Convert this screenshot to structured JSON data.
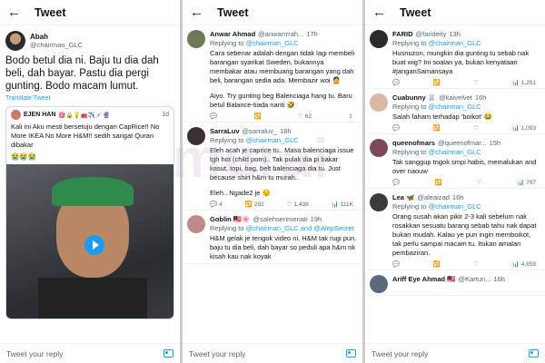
{
  "panels": [
    {
      "title": "Tweet",
      "reply_placeholder": "Tweet your reply",
      "main": {
        "name": "Abah",
        "handle": "@chairman_GLC",
        "text": "Bodo betul dia ni. Baju tu dia dah beli, dah bayar. Pastu dia pergi gunting. Bodo macam lumut.",
        "translate": "Translate Tweet",
        "quote": {
          "name": "EJEN HAN",
          "emoji": "🎯🔒💡🚒✈️💉🔮",
          "time": "1d",
          "text": "Kali ini Aku mesti bersetuju dengan CapRice!! No More IKEA No More H&M!! sedih sangat Quran dibakar",
          "emojis": "😭😭😭"
        }
      }
    },
    {
      "title": "Tweet",
      "reply_placeholder": "Tweet your reply",
      "tweets": [
        {
          "name": "Anwar Ahmad",
          "handle": "@anwarrrrah...",
          "time": "17h",
          "reply_to": "@chairman_GLC",
          "text": "Cara sebenar adalah dengan tidak lagi membeli barangan syarikat Sweden, bukannya membakar atau membuang barangan yang dah beli, barangan sedia ada. Membazir woi 🤦",
          "text2": "Aiyo. Try gunting beg Balenciaga hang tu. Baru betul Balance-tiada nanti 🤣",
          "likes": "62"
        },
        {
          "name": "SarraLuv",
          "handle": "@sarraluv_",
          "time": "18h",
          "reply_to": "@chairman_GLC",
          "text": "Eleh acah je caprice tu.. Masa balenciaga issue tgh hot (child porn).. Tak pulak dia pi bakar kasut, topi, bag, belt balenciaga dia tu. Just because shirt h&m tu murah..",
          "text2": "Eleh.. Ngade2 je 😒",
          "replies": "4",
          "retweets": "292",
          "likes": "1,438",
          "views": "111K"
        },
        {
          "name": "Goblin 🇲🇾🌸",
          "handle": "@salehserimenati",
          "time": "19h",
          "reply_to": "@chairman_GLC and @AlepSecret",
          "text": "H&M gelak je tengok video ni. H&M tak rugi pun. baju tu dia beli, dah bayar so peduli apa h&m nk kisah kau nak koyak"
        }
      ]
    },
    {
      "title": "Tweet",
      "reply_placeholder": "Tweet your reply",
      "tweets": [
        {
          "name": "FARID",
          "handle": "@farideity",
          "time": "13h",
          "reply_to": "@chairman_GLC",
          "text": "Husnuzon, mungkin dia gunting tu sebab nak buat wig? Ini soalan ya, bukan kenyataan #janganSamansaya",
          "views": "1,251"
        },
        {
          "name": "Cuabunny 🐰",
          "handle": "@kaivelvet",
          "time": "16h",
          "reply_to": "@chairman_GLC",
          "text": "Salah faham terhadap 'boikot' 😂",
          "views": "1,093"
        },
        {
          "name": "queenofmars",
          "handle": "@queenofmar...",
          "time": "15h",
          "reply_to": "@chairman_GLC",
          "text": "Tak sanggup tngok smpi habis, memalukan and over naouw",
          "views": "797"
        },
        {
          "name": "Lea 🦋",
          "handle": "@aleaizad",
          "time": "16h",
          "reply_to": "@chairman_GLC",
          "text": "Orang susah akan pikir 2-3 kali sebelum nak rosakkan sesuatu barang sebab tahu nak dapat bukan mudah. Kalau ye pun ingin memboikot, tak perlu sampai macam tu. Itukan amalan pembaziran.",
          "views": "4,859"
        },
        {
          "name": "Ariff Eye Ahmad 🇲🇾",
          "handle": "@Kartun...",
          "time": "16h"
        }
      ]
    }
  ],
  "watermark": "murai",
  "colors": {
    "link": "#1d9bf0",
    "muted": "#536471",
    "text": "#0f1419"
  }
}
